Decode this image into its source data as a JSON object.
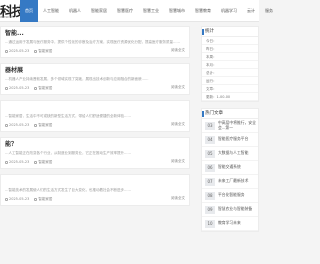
{
  "header": {
    "logo": "科技",
    "logo_sub": "www.cn",
    "nav": [
      "首页",
      "人工智能",
      "机器人",
      "智能家居",
      "智慧医疗",
      "智慧工业",
      "智慧城市",
      "智慧教育",
      "机器学习",
      "云计",
      "服务"
    ]
  },
  "articles": [
    {
      "title": "智能...",
      "excerpt": "…通过运用于发展与医疗服务中，提供个性化的诊断及治疗方案，实现医疗资源优化分配，提高医疗服务质量……",
      "date": "2025-05-23",
      "category": "智能家居",
      "more": "阅读全文"
    },
    {
      "title": "器材展",
      "excerpt": "…机器人产业持续蓬勃发展，多个领域实现了突破，展现出技术创新与应用融合的新面貌……",
      "date": "2025-05-23",
      "category": "智能家居",
      "more": "阅读全文"
    },
    {
      "title": "",
      "excerpt": "…智能家居，生活中不可或缺的新型生活方式，带给人们舒适便捷的全新体验……",
      "date": "2025-05-23",
      "category": "智能家居",
      "more": "阅读全文"
    },
    {
      "title": "能？",
      "excerpt": "…人工智能正在改变各个行业，从制造业到服务业，它正在推动生产效率提升……",
      "date": "2025-05-23",
      "category": "智能家居",
      "more": "阅读全文"
    },
    {
      "title": "",
      "excerpt": "…智能技术的发展使人们的生活方式发生了巨大变化，也推动着社会不断进步……",
      "date": "2025-05-23",
      "category": "智能家居",
      "more": "阅读全文"
    }
  ],
  "sidebar": {
    "stats_title": "统计",
    "stats": [
      "今日：",
      "昨日：",
      "本周：",
      "本月：",
      "总计：",
      "运行：",
      "文章：",
      "更新：1-00-00"
    ],
    "hot_title": "热门文章",
    "hot": [
      {
        "rank": "03",
        "text": "中高层中将推行，安全会...第一"
      },
      {
        "rank": "04",
        "text": "智能医疗服务平台"
      },
      {
        "rank": "05",
        "text": "大数据与人工智能"
      },
      {
        "rank": "06",
        "text": "智能交通系统"
      },
      {
        "rank": "07",
        "text": "未来工厂最新技术"
      },
      {
        "rank": "08",
        "text": "平台化智能服务"
      },
      {
        "rank": "09",
        "text": "智慧农业与智能装备"
      },
      {
        "rank": "10",
        "text": "教育学习未来"
      }
    ]
  }
}
